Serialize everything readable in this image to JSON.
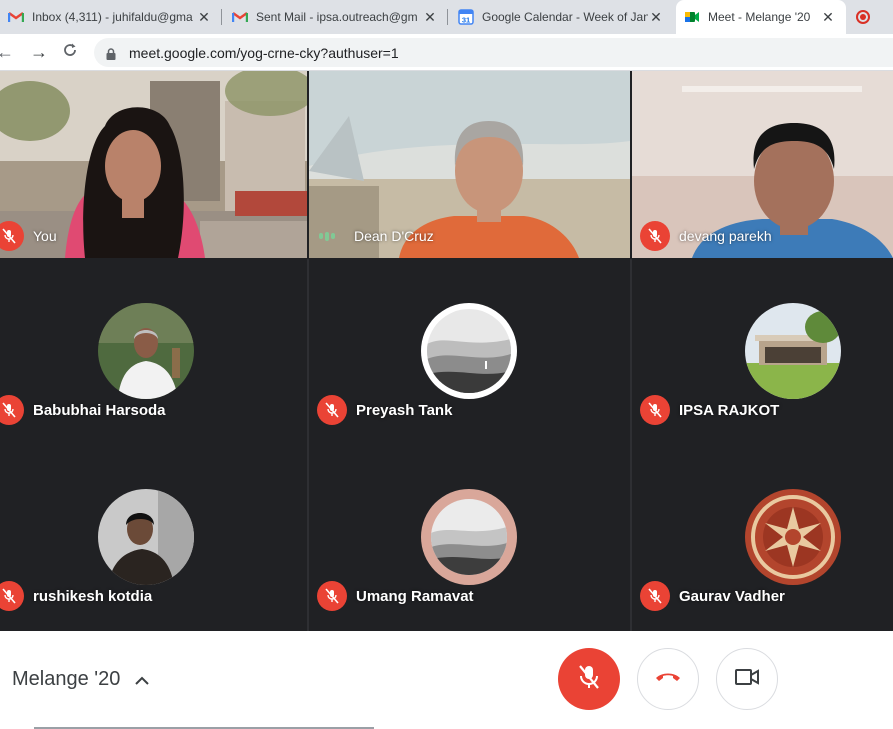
{
  "browser": {
    "tabs": [
      {
        "title": "Inbox (4,311) - juhifaldu@gma",
        "icon": "gmail-icon",
        "close": "✕"
      },
      {
        "title": "Sent Mail - ipsa.outreach@gm",
        "icon": "gmail-icon",
        "close": "✕"
      },
      {
        "title": "Google Calendar - Week of Jan",
        "icon": "calendar-icon",
        "close": "✕",
        "calendar_day": "31"
      },
      {
        "title": "Meet - Melange '20",
        "icon": "meet-icon",
        "close": "✕"
      }
    ],
    "url": "meet.google.com/yog-crne-cky?authuser=1",
    "recording_indicator_color": "#d93025"
  },
  "participants": [
    {
      "name": "You",
      "muted": true,
      "style": "video"
    },
    {
      "name": "Dean D'Cruz",
      "muted": false,
      "speaking": true,
      "style": "video"
    },
    {
      "name": "devang parekh",
      "muted": true,
      "style": "video"
    },
    {
      "name": "Babubhai Harsoda",
      "muted": true,
      "style": "avatar"
    },
    {
      "name": "Preyash Tank",
      "muted": true,
      "style": "avatar"
    },
    {
      "name": "IPSA RAJKOT",
      "muted": true,
      "style": "avatar"
    },
    {
      "name": "rushikesh kotdia",
      "muted": true,
      "style": "avatar"
    },
    {
      "name": "Umang Ramavat",
      "muted": true,
      "style": "avatar"
    },
    {
      "name": "Gaurav Vadher",
      "muted": true,
      "style": "avatar"
    }
  ],
  "meeting": {
    "title": "Melange '20",
    "controls": {
      "mic": "mic-off-icon",
      "hangup": "hang-up-icon",
      "camera": "camera-icon"
    }
  },
  "colors": {
    "accent_red": "#ea4335",
    "grid_background": "#202124",
    "speaking_green": "#81c995"
  }
}
